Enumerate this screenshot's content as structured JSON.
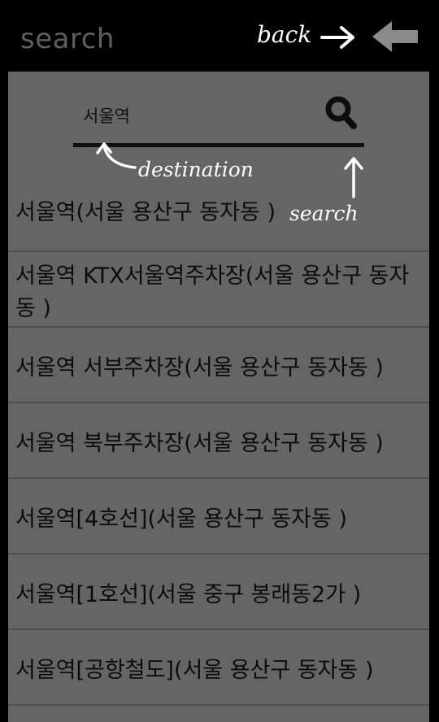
{
  "app": {
    "title": "search"
  },
  "annotations": {
    "back": "back",
    "destination": "destination",
    "search": "search"
  },
  "search": {
    "value": "서울역",
    "placeholder": ""
  },
  "results": [
    "서울역(서울 용산구 동자동 )",
    "서울역 KTX서울역주차장(서울 용산구 동자동 )",
    "서울역 서부주차장(서울 용산구 동자동 )",
    "서울역 북부주차장(서울 용산구 동자동 )",
    "서울역[4호선](서울 용산구 동자동 )",
    "서울역[1호선](서울 중구 봉래동2가 )",
    "서울역[공항철도](서울 용산구 동자동 )"
  ],
  "icons": {
    "back_button": "left-arrow-icon",
    "search_button": "search-icon"
  },
  "colors": {
    "topbar": "#000000",
    "panel": "#656565",
    "title_text": "#5f5f5f",
    "annotation_text": "#ffffff"
  }
}
